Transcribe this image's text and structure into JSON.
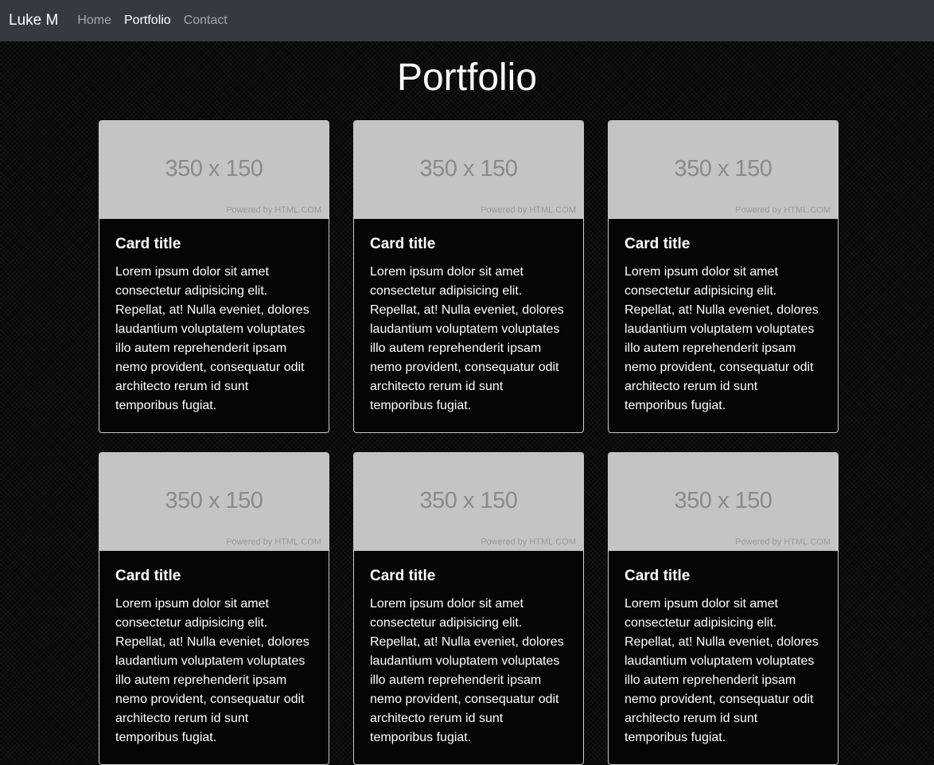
{
  "navbar": {
    "brand": "Luke M",
    "links": [
      {
        "label": "Home",
        "active": false
      },
      {
        "label": "Portfolio",
        "active": true
      },
      {
        "label": "Contact",
        "active": false
      }
    ]
  },
  "page": {
    "title": "Portfolio"
  },
  "cards": [
    {
      "image_text": "350 x 150",
      "image_credit": "Powered by HTML.COM",
      "title": "Card title",
      "text": "Lorem ipsum dolor sit amet consectetur adipisicing elit. Repellat, at! Nulla eveniet, dolores laudantium voluptatem voluptates illo autem reprehenderit ipsam nemo provident, consequatur odit architecto rerum id sunt temporibus fugiat."
    },
    {
      "image_text": "350 x 150",
      "image_credit": "Powered by HTML.COM",
      "title": "Card title",
      "text": "Lorem ipsum dolor sit amet consectetur adipisicing elit. Repellat, at! Nulla eveniet, dolores laudantium voluptatem voluptates illo autem reprehenderit ipsam nemo provident, consequatur odit architecto rerum id sunt temporibus fugiat."
    },
    {
      "image_text": "350 x 150",
      "image_credit": "Powered by HTML.COM",
      "title": "Card title",
      "text": "Lorem ipsum dolor sit amet consectetur adipisicing elit. Repellat, at! Nulla eveniet, dolores laudantium voluptatem voluptates illo autem reprehenderit ipsam nemo provident, consequatur odit architecto rerum id sunt temporibus fugiat."
    },
    {
      "image_text": "350 x 150",
      "image_credit": "Powered by HTML.COM",
      "title": "Card title",
      "text": "Lorem ipsum dolor sit amet consectetur adipisicing elit. Repellat, at! Nulla eveniet, dolores laudantium voluptatem voluptates illo autem reprehenderit ipsam nemo provident, consequatur odit architecto rerum id sunt temporibus fugiat."
    },
    {
      "image_text": "350 x 150",
      "image_credit": "Powered by HTML.COM",
      "title": "Card title",
      "text": "Lorem ipsum dolor sit amet consectetur adipisicing elit. Repellat, at! Nulla eveniet, dolores laudantium voluptatem voluptates illo autem reprehenderit ipsam nemo provident, consequatur odit architecto rerum id sunt temporibus fugiat."
    },
    {
      "image_text": "350 x 150",
      "image_credit": "Powered by HTML.COM",
      "title": "Card title",
      "text": "Lorem ipsum dolor sit amet consectetur adipisicing elit. Repellat, at! Nulla eveniet, dolores laudantium voluptatem voluptates illo autem reprehenderit ipsam nemo provident, consequatur odit architecto rerum id sunt temporibus fugiat."
    }
  ],
  "colors": {
    "navbar_bg": "#343a40",
    "page_bg": "#080808",
    "placeholder_bg": "#c4c4c4",
    "placeholder_text": "#8a8a8a",
    "card_border": "#c9c9c9"
  }
}
